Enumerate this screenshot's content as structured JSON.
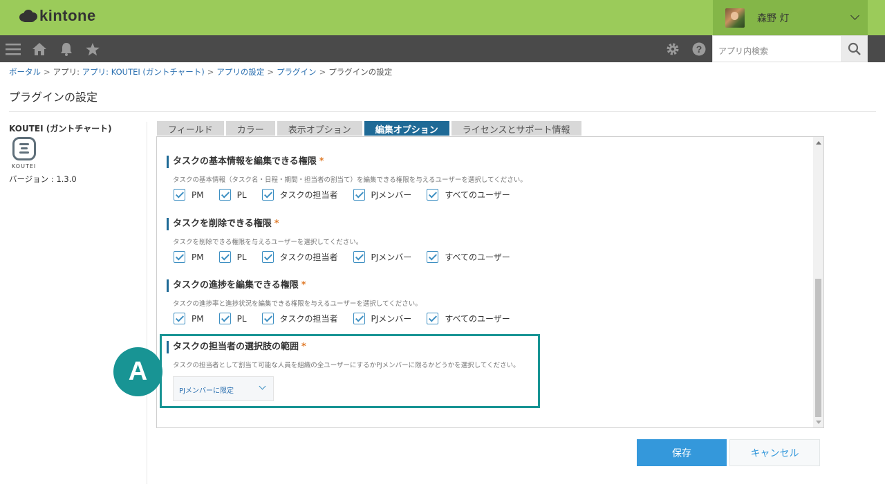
{
  "header": {
    "logo_text": "kintone",
    "user_name": "森野 灯"
  },
  "toolbar": {
    "search_placeholder": "アプリ内検索"
  },
  "breadcrumb": [
    "ポータル",
    "アプリ: KOUTEI (ガントチャート)",
    "アプリの設定",
    "プラグイン",
    "プラグインの設定"
  ],
  "page_title": "プラグインの設定",
  "plugin": {
    "name": "KOUTEI (ガントチャート)",
    "icon_label": "KOUTEI",
    "version": "バージョン : 1.3.0"
  },
  "tabs": [
    {
      "label": "フィールド",
      "active": false
    },
    {
      "label": "カラー",
      "active": false
    },
    {
      "label": "表示オプション",
      "active": false
    },
    {
      "label": "編集オプション",
      "active": true
    },
    {
      "label": "ライセンスとサポート情報",
      "active": false
    }
  ],
  "required_mark": "*",
  "checkbox_labels": [
    "PM",
    "PL",
    "タスクの担当者",
    "PJメンバー",
    "すべてのユーザー"
  ],
  "sections": [
    {
      "title": "タスクの基本情報を編集できる権限",
      "desc": "タスクの基本情報（タスク名・日程・期間・担当者の割当て）を編集できる権限を与えるユーザーを選択してください。"
    },
    {
      "title": "タスクを削除できる権限",
      "desc": "タスクを削除できる権限を与えるユーザーを選択してください。"
    },
    {
      "title": "タスクの進捗を編集できる権限",
      "desc": "タスクの進捗率と進捗状況を編集できる権限を与えるユーザーを選択してください。"
    },
    {
      "title": "タスクの担当者の選択肢の範囲",
      "desc": "タスクの担当者として割当て可能な人員を組織の全ユーザーにするかPJメンバーに限るかどうかを選択してください。",
      "select_value": "PJメンバーに限定"
    }
  ],
  "callout_label": "A",
  "buttons": {
    "save": "保存",
    "cancel": "キャンセル"
  },
  "colors": {
    "header_green": "#9bcb5a",
    "toolbar_dark": "#4a4a4a",
    "accent_blue": "#1f6a96",
    "button_blue": "#3498db",
    "highlight_teal": "#189494",
    "required_orange": "#e07b2a"
  }
}
